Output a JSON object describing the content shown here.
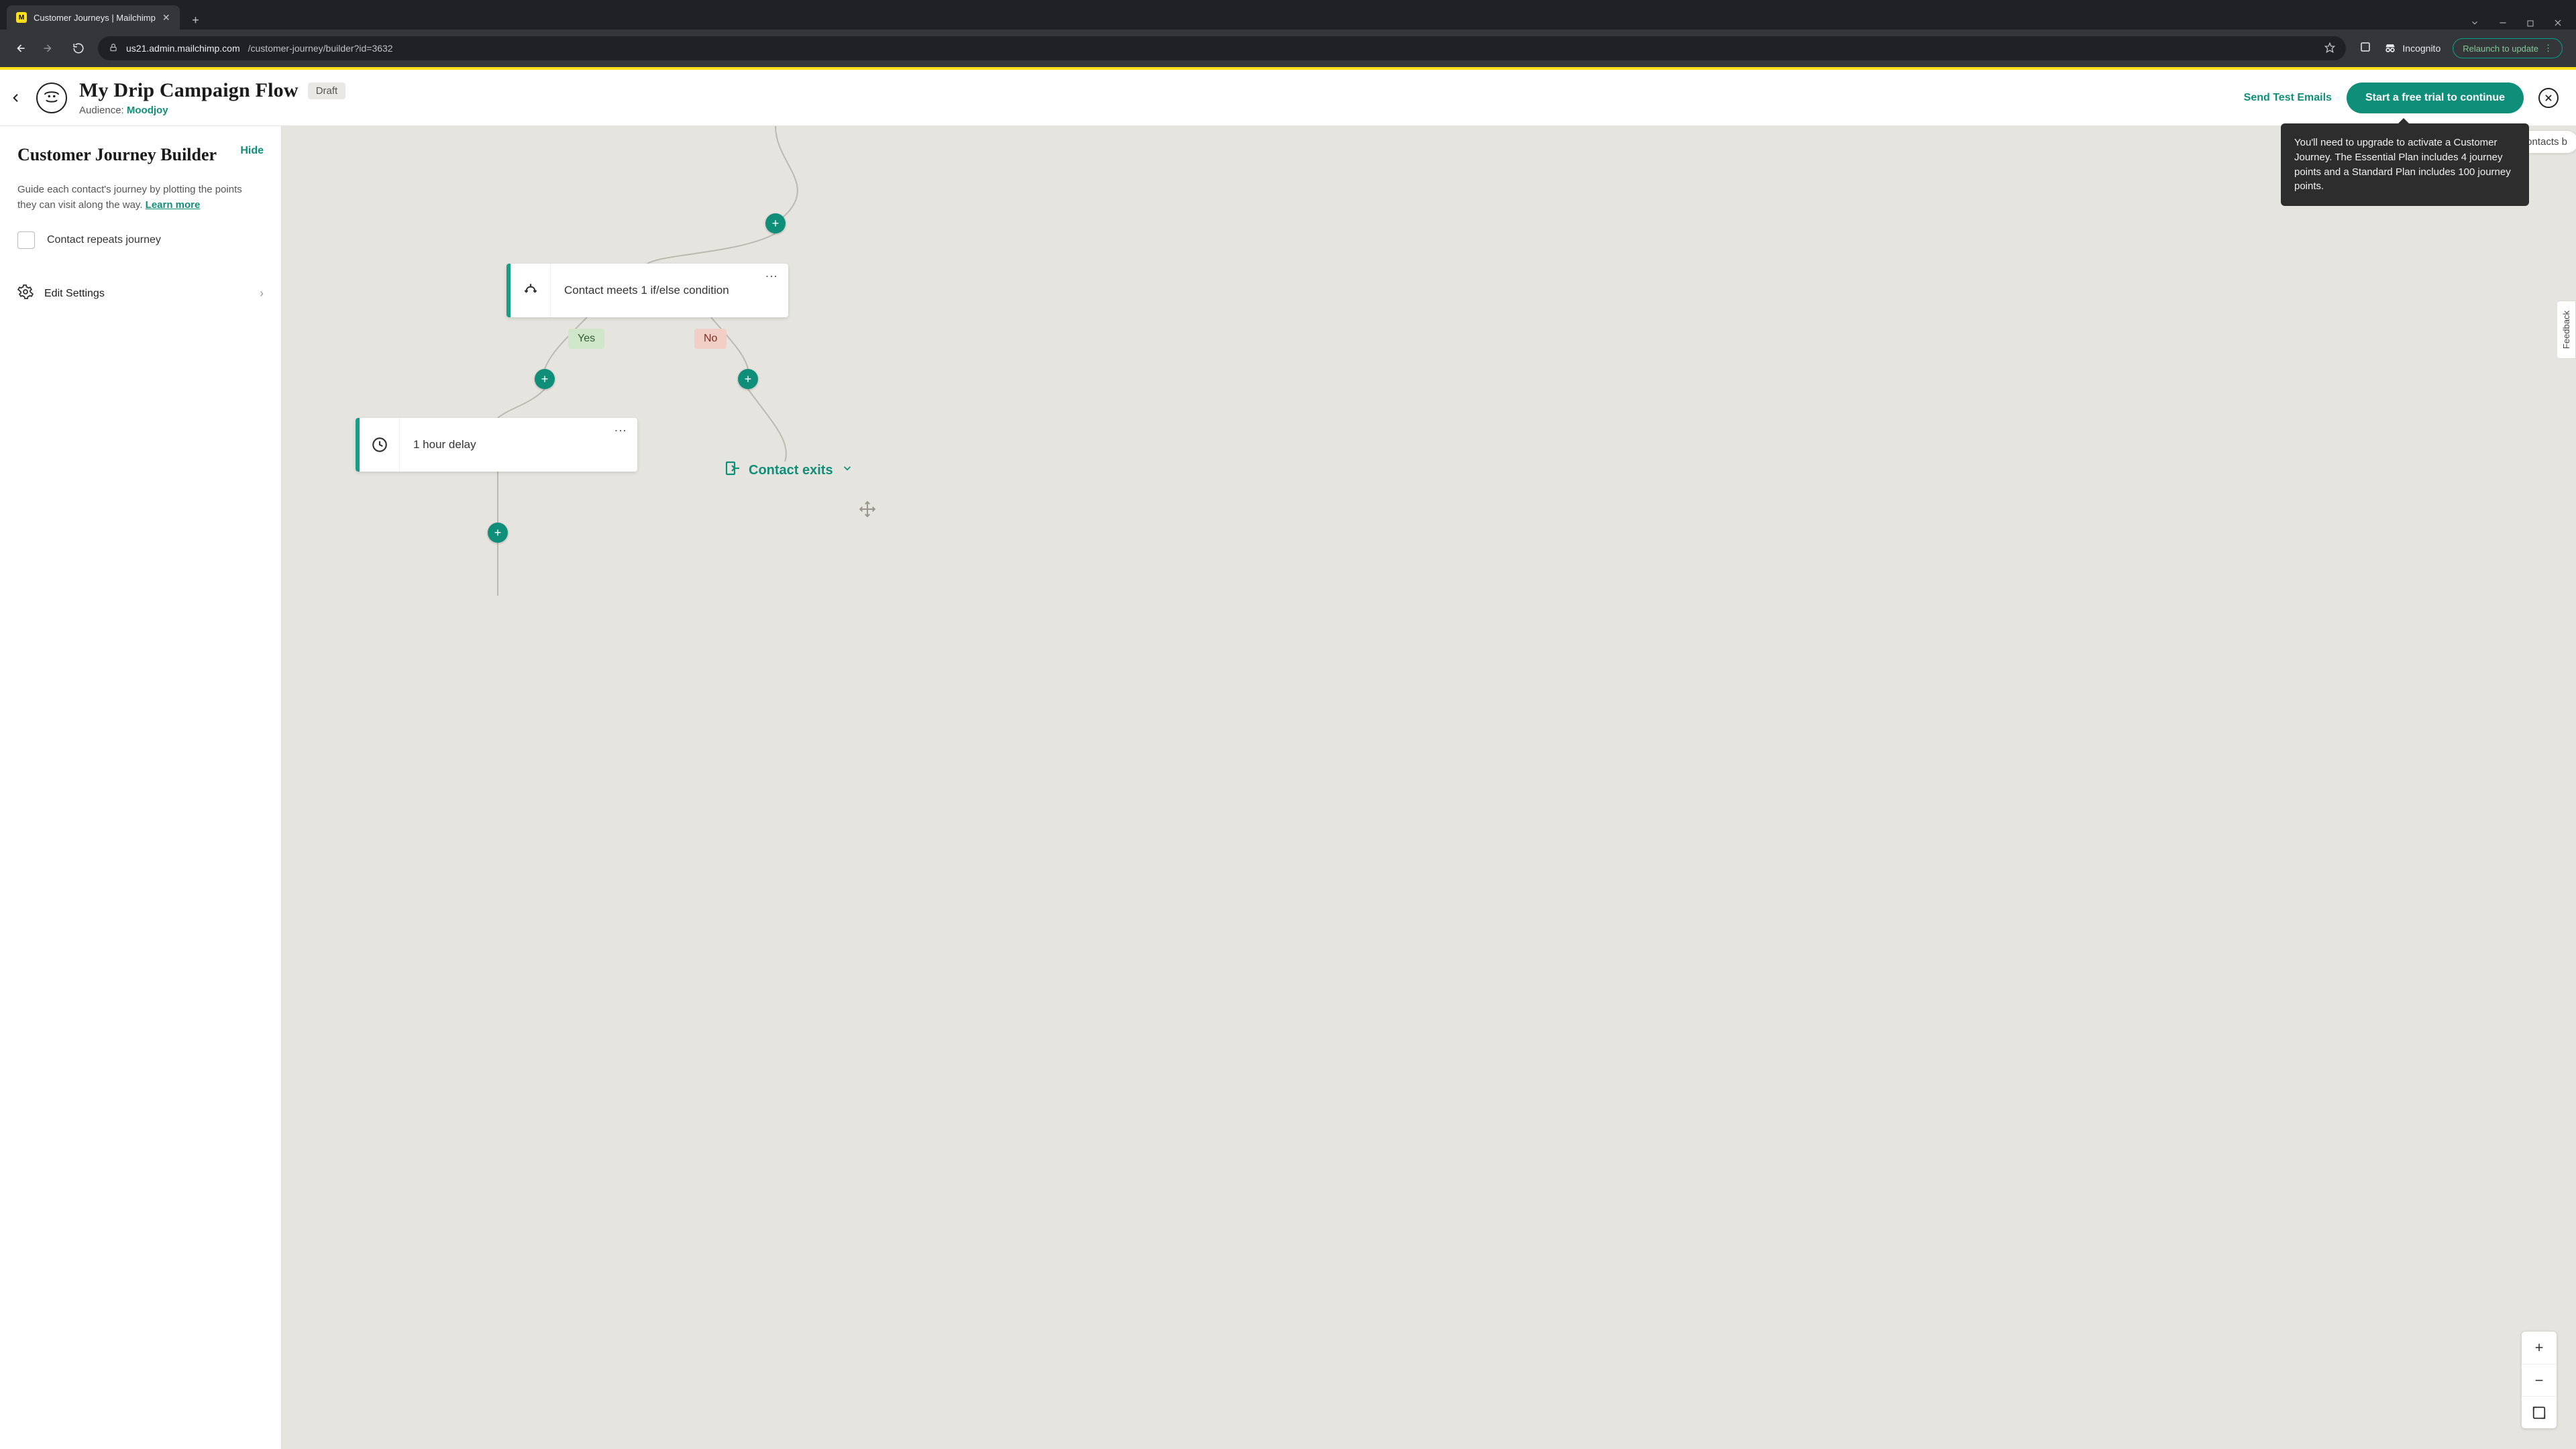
{
  "browser": {
    "tab_title": "Customer Journeys | Mailchimp",
    "url_host": "us21.admin.mailchimp.com",
    "url_path": "/customer-journey/builder?id=3632",
    "incognito_label": "Incognito",
    "relaunch_label": "Relaunch to update"
  },
  "header": {
    "title": "My Drip Campaign Flow",
    "status": "Draft",
    "audience_label": "Audience:",
    "audience_name": "Moodjoy",
    "send_test": "Send Test Emails",
    "cta": "Start a free trial to continue",
    "tooltip": "You'll need to upgrade to activate a Customer Journey. The Essential Plan includes 4 journey points and a Standard Plan includes 100 journey points."
  },
  "sidebar": {
    "title": "Customer Journey Builder",
    "hide": "Hide",
    "description": "Guide each contact's journey by plotting the points they can visit along the way.",
    "learn_more": "Learn more",
    "repeat_label": "Contact repeats journey",
    "edit_settings": "Edit Settings"
  },
  "canvas": {
    "condition_text": "Contact meets 1 if/else condition",
    "yes": "Yes",
    "no": "No",
    "delay_text": "1 hour delay",
    "contact_exits": "Contact exits",
    "contacts_chip": "ontacts b",
    "feedback": "Feedback"
  },
  "colors": {
    "accent": "#0f8f7a",
    "brand_yellow": "#ffe01b",
    "canvas_bg": "#e6e4df"
  }
}
